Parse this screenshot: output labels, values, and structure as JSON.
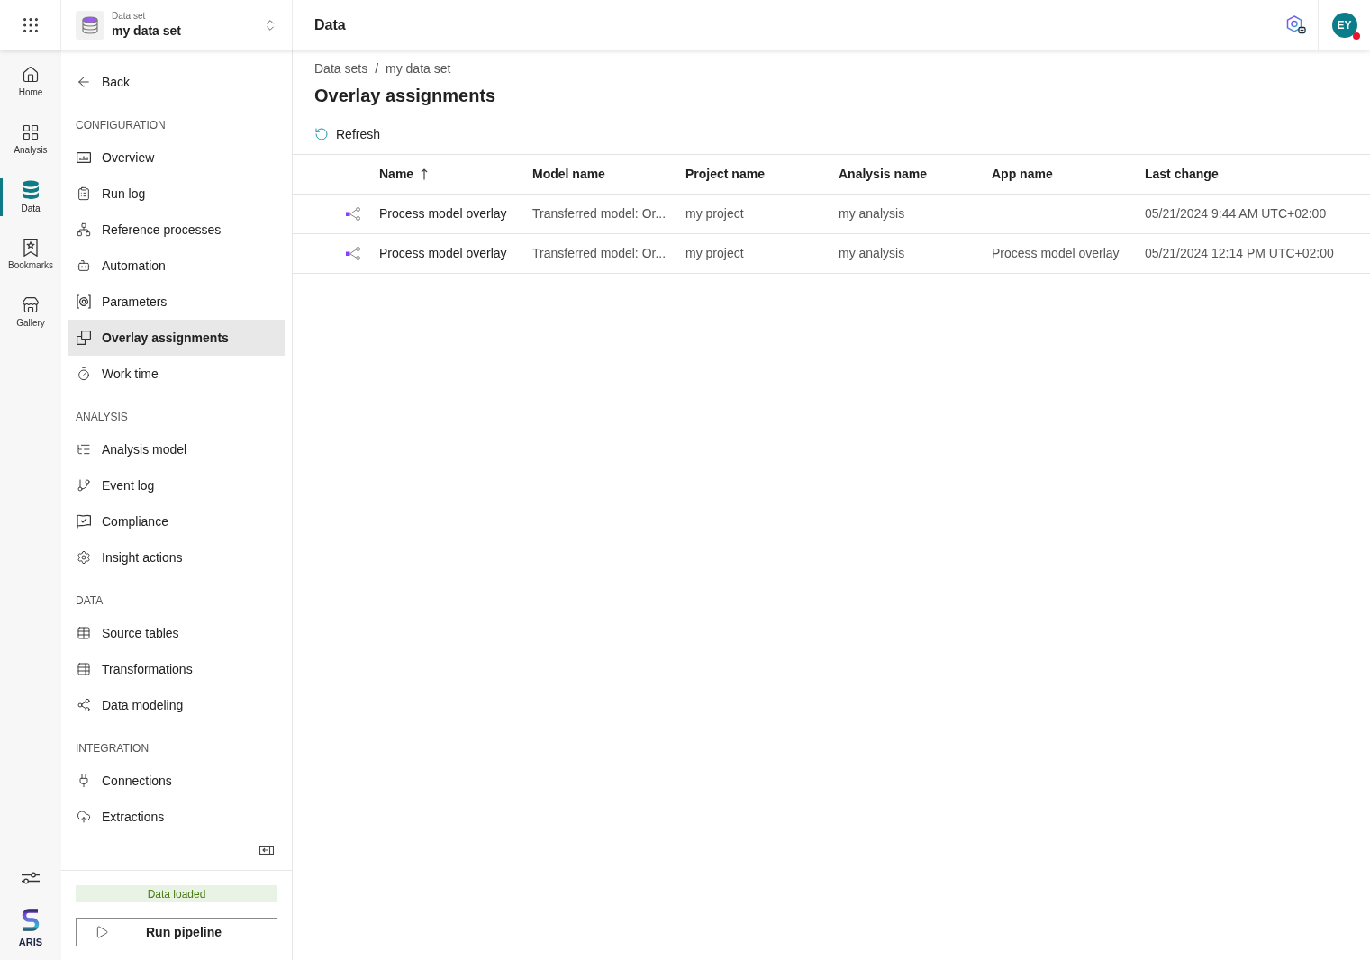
{
  "header": {
    "title": "Data"
  },
  "dataset_selector": {
    "label": "Data set",
    "value": "my data set"
  },
  "avatar": {
    "initials": "EY",
    "notification": true
  },
  "rail": {
    "items": [
      {
        "label": "Home",
        "selected": false
      },
      {
        "label": "Analysis",
        "selected": false
      },
      {
        "label": "Data",
        "selected": true
      },
      {
        "label": "Bookmarks",
        "selected": false
      },
      {
        "label": "Gallery",
        "selected": false
      }
    ],
    "logo_text": "ARIS"
  },
  "sidebar": {
    "back": "Back",
    "sections": [
      {
        "heading": "CONFIGURATION",
        "items": [
          {
            "label": "Overview",
            "selected": false
          },
          {
            "label": "Run log",
            "selected": false
          },
          {
            "label": "Reference processes",
            "selected": false
          },
          {
            "label": "Automation",
            "selected": false
          },
          {
            "label": "Parameters",
            "selected": false
          },
          {
            "label": "Overlay assignments",
            "selected": true
          },
          {
            "label": "Work time",
            "selected": false
          }
        ]
      },
      {
        "heading": "ANALYSIS",
        "items": [
          {
            "label": "Analysis model",
            "selected": false
          },
          {
            "label": "Event log",
            "selected": false
          },
          {
            "label": "Compliance",
            "selected": false
          },
          {
            "label": "Insight actions",
            "selected": false
          }
        ]
      },
      {
        "heading": "DATA",
        "items": [
          {
            "label": "Source tables",
            "selected": false
          },
          {
            "label": "Transformations",
            "selected": false
          },
          {
            "label": "Data modeling",
            "selected": false
          }
        ]
      },
      {
        "heading": "INTEGRATION",
        "items": [
          {
            "label": "Connections",
            "selected": false
          },
          {
            "label": "Extractions",
            "selected": false
          }
        ]
      }
    ],
    "status": "Data loaded",
    "run_button": "Run pipeline"
  },
  "page": {
    "breadcrumb": [
      {
        "label": "Data sets"
      },
      {
        "label": "my data set"
      }
    ],
    "separator": "/",
    "title": "Overlay assignments",
    "refresh": "Refresh"
  },
  "table": {
    "columns": [
      {
        "label": "Name",
        "sorted_ascending": true
      },
      {
        "label": "Model name",
        "sorted_ascending": false
      },
      {
        "label": "Project name",
        "sorted_ascending": false
      },
      {
        "label": "Analysis name",
        "sorted_ascending": false
      },
      {
        "label": "App name",
        "sorted_ascending": false
      },
      {
        "label": "Last change",
        "sorted_ascending": false
      }
    ],
    "rows": [
      {
        "name": "Process model overlay",
        "model_name": "Transferred model: Or...",
        "project_name": "my project",
        "analysis_name": "my analysis",
        "last_change": "05/21/2024 9:44 AM UTC+02:00"
      },
      {
        "name": "Process model overlay",
        "model_name": "Transferred model: Or...",
        "project_name": "my project",
        "analysis_name": "my analysis",
        "app_name": "Process model overlay",
        "last_change": "05/21/2024 12:14 PM UTC+02:00"
      }
    ]
  }
}
